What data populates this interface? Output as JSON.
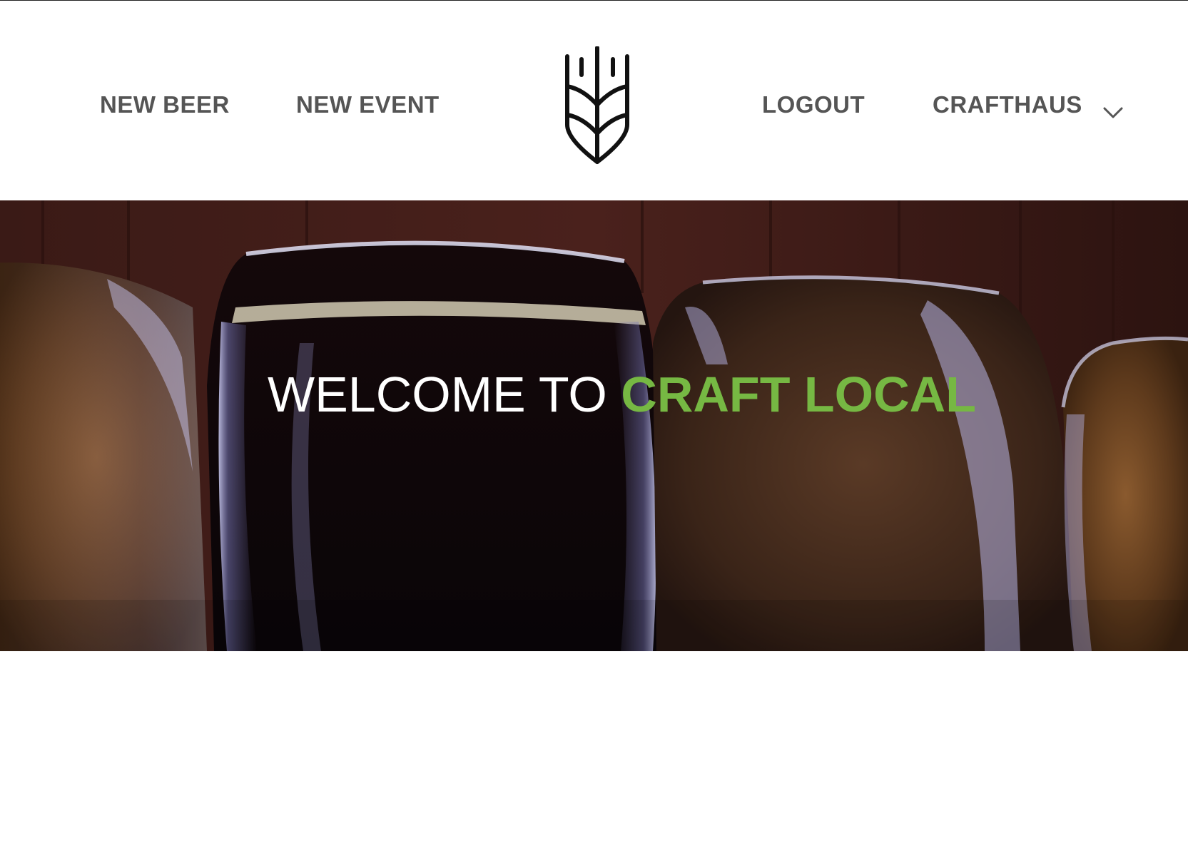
{
  "header": {
    "nav_left": [
      "NEW BEER",
      "NEW EVENT"
    ],
    "nav_right": {
      "logout_label": "LOGOUT",
      "account_label": "CRAFTHAUS"
    },
    "logo_icon": "wheat-logo-icon",
    "chevron_icon": "chevron-down-icon"
  },
  "hero": {
    "title_prefix": "WELCOME TO",
    "title_accent": "CRAFT LOCAL",
    "accent_color": "#76b843",
    "image_subject": "beer-glasses-with-malt-grains"
  },
  "colors": {
    "nav_text": "#555555",
    "title_text": "#ffffff"
  }
}
